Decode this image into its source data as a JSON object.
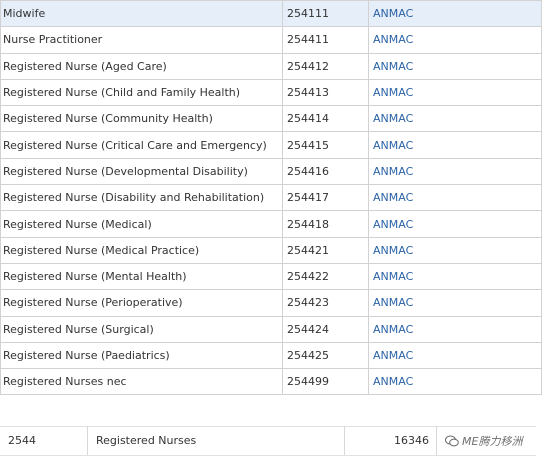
{
  "occupations": [
    {
      "title": "Midwife",
      "code": "254111",
      "body": "ANMAC",
      "highlighted": true
    },
    {
      "title": "Nurse Practitioner",
      "code": "254411",
      "body": "ANMAC"
    },
    {
      "title": "Registered Nurse (Aged Care)",
      "code": "254412",
      "body": "ANMAC"
    },
    {
      "title": "Registered Nurse (Child and Family Health)",
      "code": "254413",
      "body": "ANMAC"
    },
    {
      "title": "Registered Nurse (Community Health)",
      "code": "254414",
      "body": "ANMAC"
    },
    {
      "title": "Registered Nurse (Critical Care and Emergency)",
      "code": "254415",
      "body": "ANMAC"
    },
    {
      "title": "Registered Nurse (Developmental Disability)",
      "code": "254416",
      "body": "ANMAC"
    },
    {
      "title": "Registered Nurse (Disability and Rehabilitation)",
      "code": "254417",
      "body": "ANMAC"
    },
    {
      "title": "Registered Nurse (Medical)",
      "code": "254418",
      "body": "ANMAC"
    },
    {
      "title": "Registered Nurse (Medical Practice)",
      "code": "254421",
      "body": "ANMAC"
    },
    {
      "title": "Registered Nurse (Mental Health)",
      "code": "254422",
      "body": "ANMAC"
    },
    {
      "title": "Registered Nurse (Perioperative)",
      "code": "254423",
      "body": "ANMAC"
    },
    {
      "title": "Registered Nurse (Surgical)",
      "code": "254424",
      "body": "ANMAC"
    },
    {
      "title": "Registered Nurse (Paediatrics)",
      "code": "254425",
      "body": "ANMAC"
    },
    {
      "title": "Registered Nurses nec",
      "code": "254499",
      "body": "ANMAC"
    }
  ],
  "summary": {
    "group_code": "2544",
    "group_name": "Registered Nurses",
    "count": "16346"
  },
  "watermark": {
    "text": "ME腾力移洲",
    "icon": "wechat-icon"
  },
  "colors": {
    "link": "#2b63a6",
    "highlight_row": "#e6eefa",
    "border": "#d2d2d2"
  }
}
